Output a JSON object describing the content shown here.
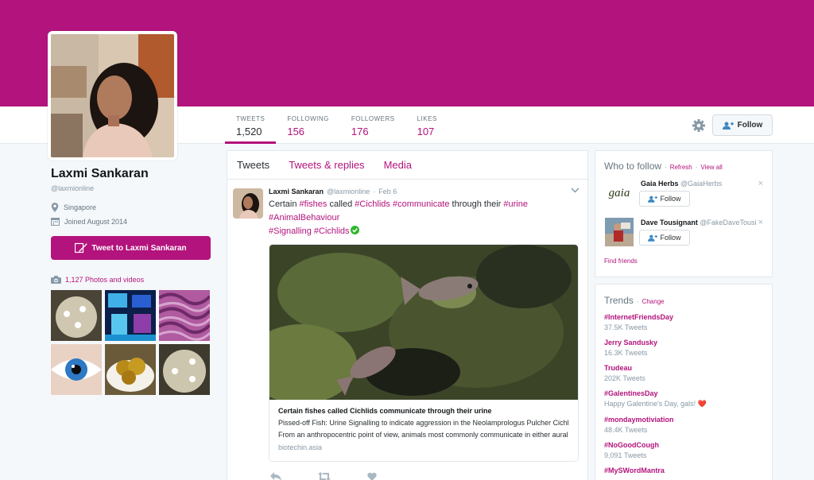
{
  "colors": {
    "accent": "#b3137c",
    "verified": "#2eb82e"
  },
  "profile": {
    "name": "Laxmi Sankaran",
    "handle": "@laxmionline",
    "location": "Singapore",
    "joined": "Joined August 2014",
    "tweet_to_label": "Tweet to Laxmi Sankaran",
    "photos_label": "1,127 Photos and videos"
  },
  "nav": {
    "stats": [
      {
        "label": "TWEETS",
        "value": "1,520"
      },
      {
        "label": "FOLLOWING",
        "value": "156"
      },
      {
        "label": "FOLLOWERS",
        "value": "176"
      },
      {
        "label": "LIKES",
        "value": "107"
      }
    ],
    "follow_label": "Follow",
    "settings_icon": "gear-icon"
  },
  "timeline": {
    "tabs": [
      "Tweets",
      "Tweets & replies",
      "Media"
    ],
    "tweet": {
      "name": "Laxmi Sankaran",
      "handle": "@laxmionline",
      "sep": "·",
      "date": "Feb 6",
      "text": {
        "t1": "Certain ",
        "h1": "#fishes",
        "t2": " called ",
        "h2": "#Cichlids",
        "t3": " ",
        "h3": "#communicate",
        "t4": " through their ",
        "h4": "#urine",
        "t5": " ",
        "h5": "#AnimalBehaviour",
        "h6": "#Signalling",
        "t6": " ",
        "h7": "#Cichlids"
      },
      "card": {
        "title": "Certain fishes called Cichlids communicate through their urine",
        "desc1": "Pissed-off Fish: Urine Signalling to indicate aggression in the Neolamprologus Pulcher Cichlid",
        "desc2": "From an anthropocentric point of view, animals most commonly communicate in either aural ...",
        "domain": "biotechin.asia"
      }
    }
  },
  "who_to_follow": {
    "title": "Who to follow",
    "sep": "·",
    "refresh": "Refresh",
    "view_all": "View all",
    "suggestions": [
      {
        "name": "Gaia Herbs",
        "handle": "@GaiaHerbs",
        "logo_text": "gaia",
        "button": "Follow"
      },
      {
        "name": "Dave Tousignant",
        "handle": "@FakeDaveTousi",
        "button": "Follow"
      }
    ],
    "find_friends": "Find friends",
    "close_glyph": "×"
  },
  "trends": {
    "title": "Trends",
    "sep": "·",
    "change": "Change",
    "items": [
      {
        "tag": "#InternetFriendsDay",
        "count": "37.5K Tweets"
      },
      {
        "tag": "Jerry Sandusky",
        "count": "16.3K Tweets"
      },
      {
        "tag": "Trudeau",
        "count": "202K Tweets"
      },
      {
        "tag": "#GalentinesDay",
        "count": "Happy Galentine's Day, gals! ❤️"
      },
      {
        "tag": "#mondaymotiviation",
        "count": "48.4K Tweets"
      },
      {
        "tag": "#NoGoodCough",
        "count": "9,091 Tweets"
      },
      {
        "tag": "#MySWordMantra",
        "count": ""
      }
    ]
  }
}
